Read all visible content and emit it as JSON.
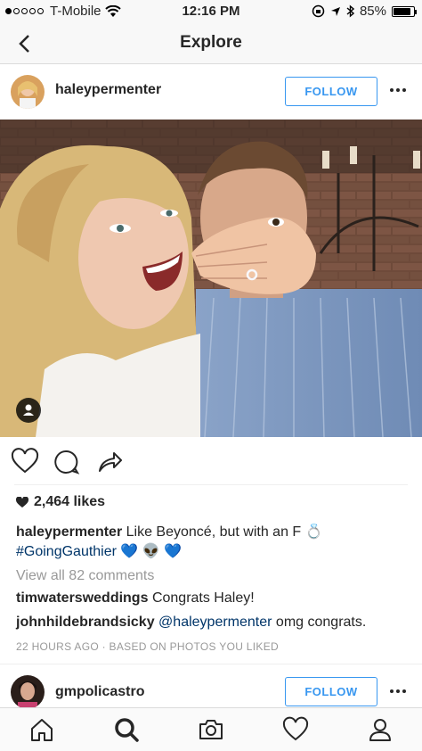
{
  "status_bar": {
    "carrier": "T-Mobile",
    "time": "12:16 PM",
    "battery": "85%",
    "battery_level": 0.85,
    "signal_bars": 1
  },
  "nav": {
    "title": "Explore",
    "back_icon": "chevron-left-icon"
  },
  "post": {
    "username": "haleypermenter",
    "follow_label": "FOLLOW",
    "likes": "2,464 likes",
    "caption_username": "haleypermenter",
    "caption_text": "Like Beyoncé, but with an F 💍",
    "caption_hashtag": "#GoingGauthier",
    "caption_emoji": "💙 👽 💙",
    "view_all_comments": "View all 82 comments",
    "comments": [
      {
        "username": "timwatersweddings",
        "text": "Congrats Haley!"
      },
      {
        "username": "johnhildebrandsicky",
        "mention": "@haleypermenter",
        "text": "omg congrats."
      }
    ],
    "timestamp": "22 HOURS AGO",
    "timestamp_separator": " · ",
    "timestamp_source": "BASED ON PHOTOS YOU LIKED"
  },
  "next_post": {
    "username": "gmpolicastro",
    "follow_label": "FOLLOW"
  },
  "tab_bar": {
    "items": [
      "home-icon",
      "search-icon",
      "camera-icon",
      "heart-icon",
      "profile-icon"
    ],
    "active": "search-icon"
  },
  "colors": {
    "accent": "#3897f0",
    "link": "#003569",
    "muted": "#999999",
    "text": "#262626"
  }
}
